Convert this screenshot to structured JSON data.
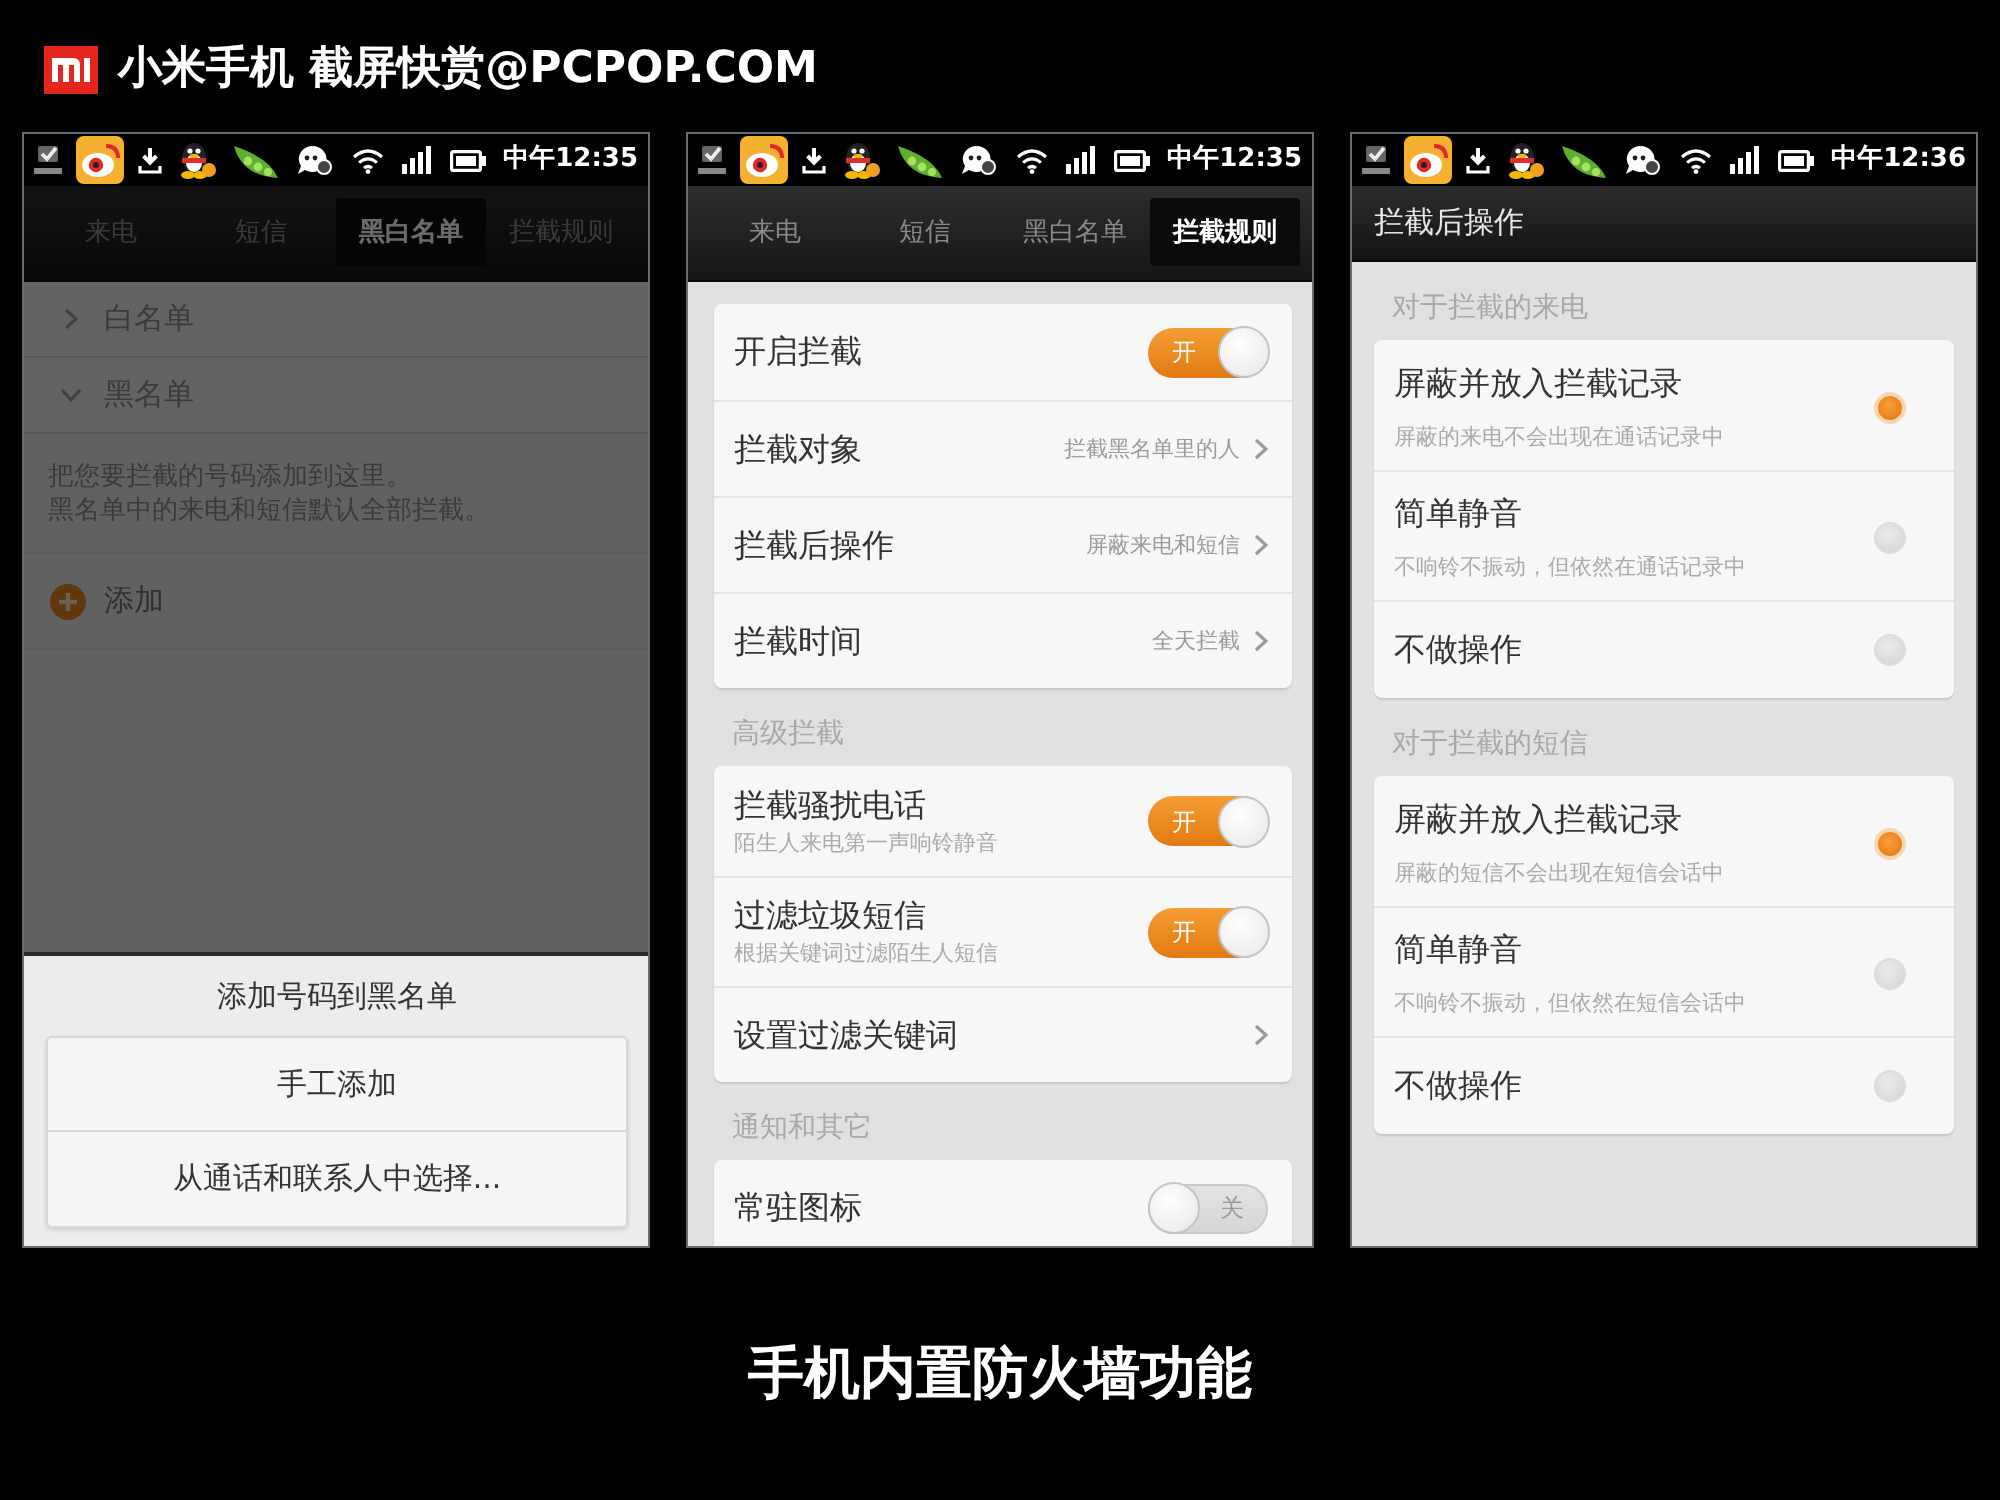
{
  "header": {
    "title": "小米手机 截屏快赏@PCPOP.COM"
  },
  "phones": [
    {
      "status_bar": {
        "time": "中午12:35"
      },
      "tabs": [
        {
          "label": "来电",
          "selected": false
        },
        {
          "label": "短信",
          "selected": false
        },
        {
          "label": "黑白名单",
          "selected": true
        },
        {
          "label": "拦截规则",
          "selected": false
        }
      ],
      "list": {
        "groups": [
          {
            "label": "白名单",
            "expanded": false
          },
          {
            "label": "黑名单",
            "expanded": true
          }
        ],
        "hint_lines": [
          "把您要拦截的号码添加到这里。",
          "黑名单中的来电和短信默认全部拦截。"
        ],
        "add_label": "添加"
      },
      "dialog": {
        "title": "添加号码到黑名单",
        "buttons": [
          "手工添加",
          "从通话和联系人中选择..."
        ]
      }
    },
    {
      "status_bar": {
        "time": "中午12:35"
      },
      "tabs": [
        {
          "label": "来电",
          "selected": false
        },
        {
          "label": "短信",
          "selected": false
        },
        {
          "label": "黑白名单",
          "selected": false
        },
        {
          "label": "拦截规则",
          "selected": true
        }
      ],
      "sections": [
        {
          "items": [
            {
              "kind": "toggle",
              "title": "开启拦截",
              "on": true,
              "switch_label": "开"
            },
            {
              "kind": "link",
              "title": "拦截对象",
              "value": "拦截黑名单里的人"
            },
            {
              "kind": "link",
              "title": "拦截后操作",
              "value": "屏蔽来电和短信"
            },
            {
              "kind": "link",
              "title": "拦截时间",
              "value": "全天拦截"
            }
          ]
        },
        {
          "header": "高级拦截",
          "items": [
            {
              "kind": "toggle",
              "title": "拦截骚扰电话",
              "subtitle": "陌生人来电第一声响铃静音",
              "on": true,
              "switch_label": "开"
            },
            {
              "kind": "toggle",
              "title": "过滤垃圾短信",
              "subtitle": "根据关键词过滤陌生人短信",
              "on": true,
              "switch_label": "开"
            },
            {
              "kind": "link",
              "title": "设置过滤关键词"
            }
          ]
        },
        {
          "header": "通知和其它",
          "items": [
            {
              "kind": "toggle",
              "title": "常驻图标",
              "on": false,
              "switch_label": "关"
            }
          ]
        }
      ]
    },
    {
      "status_bar": {
        "time": "中午12:36"
      },
      "title_bar": "拦截后操作",
      "sections": [
        {
          "header": "对于拦截的来电",
          "items": [
            {
              "kind": "radio",
              "title": "屏蔽并放入拦截记录",
              "subtitle": "屏蔽的来电不会出现在通话记录中",
              "selected": true
            },
            {
              "kind": "radio",
              "title": "简单静音",
              "subtitle": "不响铃不振动，但依然在通话记录中",
              "selected": false
            },
            {
              "kind": "radio",
              "title": "不做操作",
              "selected": false
            }
          ]
        },
        {
          "header": "对于拦截的短信",
          "items": [
            {
              "kind": "radio",
              "title": "屏蔽并放入拦截记录",
              "subtitle": "屏蔽的短信不会出现在短信会话中",
              "selected": true
            },
            {
              "kind": "radio",
              "title": "简单静音",
              "subtitle": "不响铃不振动，但依然在短信会话中",
              "selected": false
            },
            {
              "kind": "radio",
              "title": "不做操作",
              "selected": false
            }
          ]
        }
      ]
    }
  ],
  "caption": "手机内置防火墙功能"
}
